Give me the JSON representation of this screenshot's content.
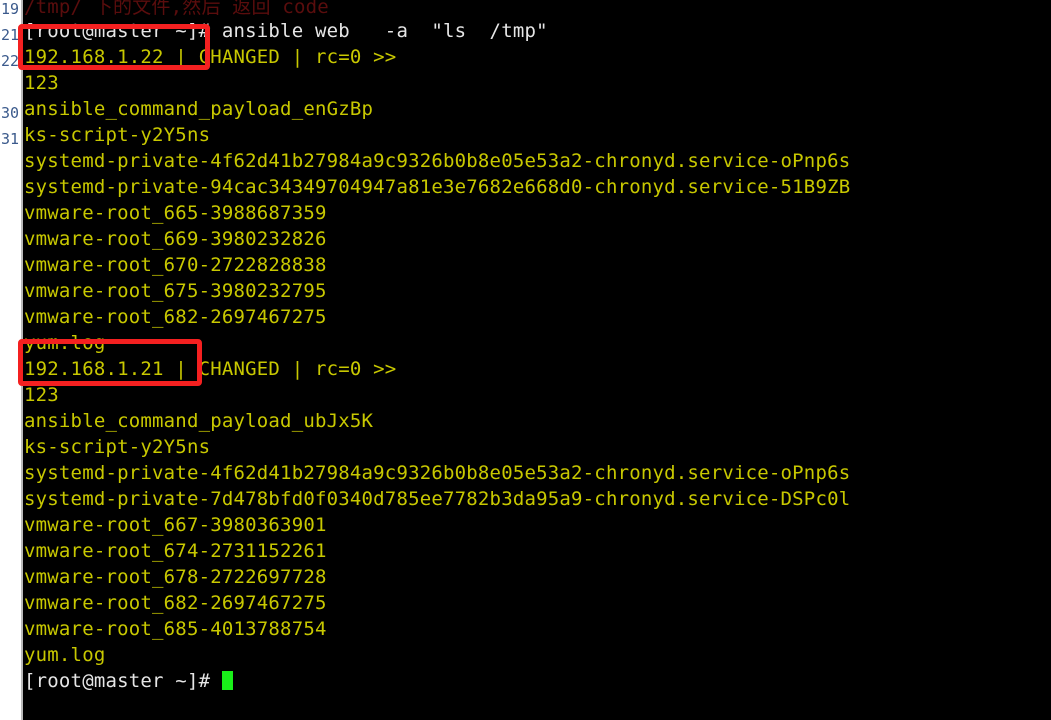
{
  "terminal": {
    "prompt": "[root@master ~]#",
    "cursor_color": "#19f019",
    "foreground_yellow": "#c8c800",
    "foreground_white": "#e6e6e6",
    "background": "#000000",
    "lines": [
      {
        "text": "/tmp/ 下的文件,然后 返回 code",
        "color": "dark",
        "clipped": true
      },
      {
        "text": "[root@master ~]# ansible web   -a  \"ls  /tmp\"",
        "color": "white"
      },
      {
        "text": "192.168.1.22 | CHANGED | rc=0 >>",
        "color": "yellow"
      },
      {
        "text": "123",
        "color": "yellow"
      },
      {
        "text": "ansible_command_payload_enGzBp",
        "color": "yellow"
      },
      {
        "text": "ks-script-y2Y5ns",
        "color": "yellow"
      },
      {
        "text": "systemd-private-4f62d41b27984a9c9326b0b8e05e53a2-chronyd.service-oPnp6s",
        "color": "yellow"
      },
      {
        "text": "systemd-private-94cac34349704947a81e3e7682e668d0-chronyd.service-51B9ZB",
        "color": "yellow"
      },
      {
        "text": "vmware-root_665-3988687359",
        "color": "yellow"
      },
      {
        "text": "vmware-root_669-3980232826",
        "color": "yellow"
      },
      {
        "text": "vmware-root_670-2722828838",
        "color": "yellow"
      },
      {
        "text": "vmware-root_675-3980232795",
        "color": "yellow"
      },
      {
        "text": "vmware-root_682-2697467275",
        "color": "yellow"
      },
      {
        "text": "yum.log",
        "color": "yellow"
      },
      {
        "text": "192.168.1.21 | CHANGED | rc=0 >>",
        "color": "yellow"
      },
      {
        "text": "123",
        "color": "yellow"
      },
      {
        "text": "ansible_command_payload_ubJx5K",
        "color": "yellow"
      },
      {
        "text": "ks-script-y2Y5ns",
        "color": "yellow"
      },
      {
        "text": "systemd-private-4f62d41b27984a9c9326b0b8e05e53a2-chronyd.service-oPnp6s",
        "color": "yellow"
      },
      {
        "text": "systemd-private-7d478bfd0f0340d785ee7782b3da95a9-chronyd.service-DSPc0l",
        "color": "yellow"
      },
      {
        "text": "vmware-root_667-3980363901",
        "color": "yellow"
      },
      {
        "text": "vmware-root_674-2731152261",
        "color": "yellow"
      },
      {
        "text": "vmware-root_678-2722697728",
        "color": "yellow"
      },
      {
        "text": "vmware-root_682-2697467275",
        "color": "yellow"
      },
      {
        "text": "vmware-root_685-4013788754",
        "color": "yellow"
      },
      {
        "text": "yum.log",
        "color": "yellow"
      }
    ],
    "final_prompt": "[root@master ~]# "
  },
  "gutter": {
    "background": "#ffffff",
    "text_color": "#3b5a8c",
    "numbers": [
      "19",
      "21",
      "22",
      "",
      "30",
      "31",
      "",
      "",
      "",
      "",
      "",
      "",
      "",
      "",
      "",
      "",
      "",
      "",
      "",
      "",
      "",
      "",
      "",
      "",
      "",
      "",
      ""
    ]
  },
  "annotations": {
    "color": "#f42020",
    "boxes": [
      {
        "label": "192.168.1.22",
        "name": "highlight-ip-22"
      },
      {
        "label": "192.168.1.21",
        "name": "highlight-ip-21"
      }
    ]
  }
}
